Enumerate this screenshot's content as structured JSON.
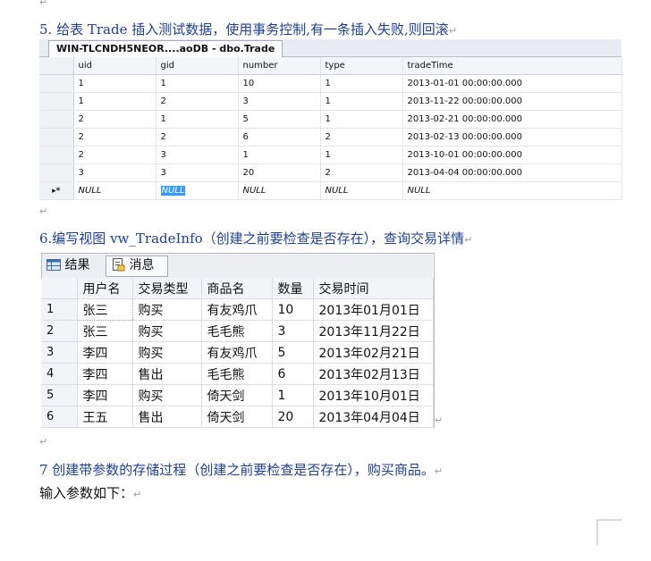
{
  "return_mark": "↵",
  "section5": {
    "heading": "5. 给表 Trade 插入测试数据，使用事务控制,有一条插入失败,则回滚"
  },
  "ssms": {
    "tab_title": "WIN-TLCNDH5NEOR....aoDB - dbo.Trade",
    "columns": [
      "uid",
      "gid",
      "number",
      "type",
      "tradeTime"
    ],
    "rows": [
      [
        "1",
        "1",
        "10",
        "1",
        "2013-01-01 00:00:00.000"
      ],
      [
        "1",
        "2",
        "3",
        "1",
        "2013-11-22 00:00:00.000"
      ],
      [
        "2",
        "1",
        "5",
        "1",
        "2013-02-21 00:00:00.000"
      ],
      [
        "2",
        "2",
        "6",
        "2",
        "2013-02-13 00:00:00.000"
      ],
      [
        "2",
        "3",
        "1",
        "1",
        "2013-10-01 00:00:00.000"
      ],
      [
        "3",
        "3",
        "20",
        "2",
        "2013-04-04 00:00:00.000"
      ]
    ],
    "new_row_marker": "▸*",
    "null_row": [
      "NULL",
      "NULL",
      "NULL",
      "NULL",
      "NULL"
    ]
  },
  "section6": {
    "heading": "6.编写视图 vw_TradeInfo（创建之前要检查是否存在），查询交易详情"
  },
  "results": {
    "tab_results": "结果",
    "tab_messages": "消息",
    "columns": [
      "用户名",
      "交易类型",
      "商品名",
      "数量",
      "交易时间"
    ],
    "rows": [
      [
        "1",
        "张三",
        "购买",
        "有友鸡爪",
        "10",
        "2013年01月01日"
      ],
      [
        "2",
        "张三",
        "购买",
        "毛毛熊",
        "3",
        "2013年11月22日"
      ],
      [
        "3",
        "李四",
        "购买",
        "有友鸡爪",
        "5",
        "2013年02月21日"
      ],
      [
        "4",
        "李四",
        "售出",
        "毛毛熊",
        "6",
        "2013年02月13日"
      ],
      [
        "5",
        "李四",
        "购买",
        "倚天剑",
        "1",
        "2013年10月01日"
      ],
      [
        "6",
        "王五",
        "售出",
        "倚天剑",
        "20",
        "2013年04月04日"
      ]
    ]
  },
  "section7": {
    "heading": "7 创建带参数的存储过程（创建之前要检查是否存在），购买商品。",
    "text": "输入参数如下："
  }
}
